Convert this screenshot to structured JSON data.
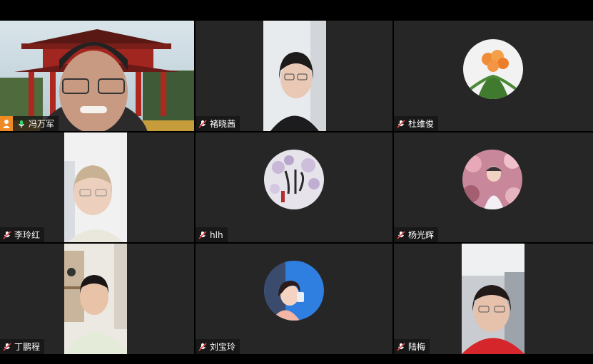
{
  "participants": [
    {
      "name": "冯万军",
      "mode": "video",
      "host": true,
      "mic": "on"
    },
    {
      "name": "褚晓茜",
      "mode": "video",
      "mic": "muted"
    },
    {
      "name": "杜维俊",
      "mode": "avatar",
      "avatar_icon": "orange-flower-icon",
      "mic": "muted"
    },
    {
      "name": "李玲红",
      "mode": "video",
      "mic": "muted"
    },
    {
      "name": "hlh",
      "mode": "avatar",
      "avatar_icon": "blossom-calligraphy-icon",
      "mic": "muted"
    },
    {
      "name": "杨光辉",
      "mode": "avatar",
      "avatar_icon": "child-flowers-icon",
      "mic": "muted"
    },
    {
      "name": "丁鹏程",
      "mode": "video",
      "mic": "muted"
    },
    {
      "name": "刘宝玲",
      "mode": "avatar",
      "avatar_icon": "cartoon-girl-icon",
      "mic": "muted"
    },
    {
      "name": "陆梅",
      "mode": "video",
      "mic": "muted"
    }
  ],
  "colors": {
    "active_speaker_border": "#2ed36c",
    "muted_mic": "#e0444b",
    "host_badge": "#f08a24",
    "tile_bg": "#262626"
  }
}
